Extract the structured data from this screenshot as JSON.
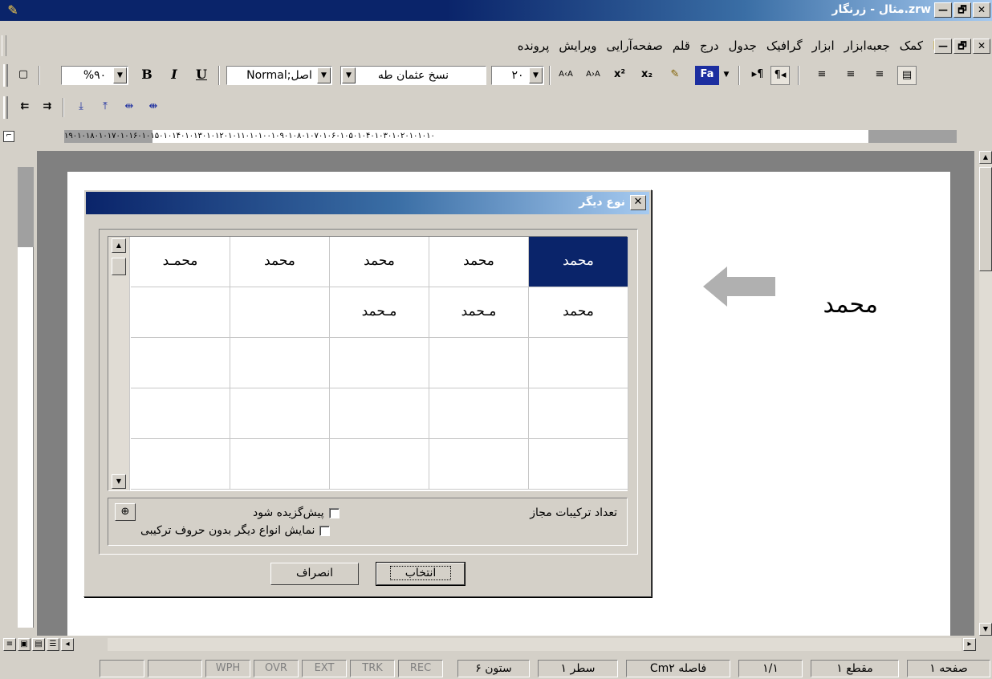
{
  "window": {
    "title": "zrw.مثال - زرنگار",
    "buttons": [
      "—",
      "🗗",
      "✕"
    ]
  },
  "menu": {
    "items": [
      "پرونده",
      "ویرایش",
      "صفحه‌آرایی",
      "قلم",
      "درج",
      "جدول",
      "گرافیک",
      "ابزار",
      "جعبه‌ابزار",
      "کمک"
    ]
  },
  "toolbar": {
    "zoom": "%۹۰",
    "bold": "B",
    "italic": "I",
    "underline": "U",
    "style": "Normal;اصل",
    "font": "نسخ عثمان طه",
    "size": "۲۰",
    "btn_fa": "Fa",
    "superscript": "x²",
    "subscript": "x₂"
  },
  "ruler": {
    "ticks": "۱۹۰۱۰۱۸۰۱۰۱۷۰۱۰۱۶۰۱۰۱۵۰۱۰۱۴۰۱۰۱۳۰۱۰۱۲۰۱۰۱۱۰۱۰۱۰۰۱۰۹۰۱۰۸۰۱۰۷۰۱۰۶۰۱۰۵۰۱۰۴۰۱۰۳۰۱۰۲۰۱۰۱۰۱۰"
  },
  "document": {
    "word": "محمد"
  },
  "dialog": {
    "title": "نوع دیگر",
    "close": "✕",
    "cells": [
      [
        "محمد",
        "محمد",
        "محمد",
        "محمد",
        "محمـد"
      ],
      [
        "محمد",
        "مـحمد",
        "مـحمد",
        "",
        ""
      ],
      [
        "",
        "",
        "",
        "",
        ""
      ],
      [
        "",
        "",
        "",
        "",
        ""
      ],
      [
        "",
        "",
        "",
        "",
        ""
      ]
    ],
    "selected_cell": "0,0",
    "option_default": "پیش‌گزیده شود",
    "option_show": "نمایش انواع دیگر بدون حروف ترکیبی",
    "count_label": "تعداد ترکیبات مجاز",
    "btn_select": "انتخاب",
    "btn_cancel": "انصراف"
  },
  "status": {
    "page": "صفحه ۱",
    "section": "مقطع ۱",
    "pages": "۱/۱",
    "distance": "فاصله Cm۲",
    "line": "سطر ۱",
    "column": "ستون ۶",
    "rec": "REC",
    "trk": "TRK",
    "ext": "EXT",
    "ovr": "OVR",
    "wph": "WPH"
  }
}
